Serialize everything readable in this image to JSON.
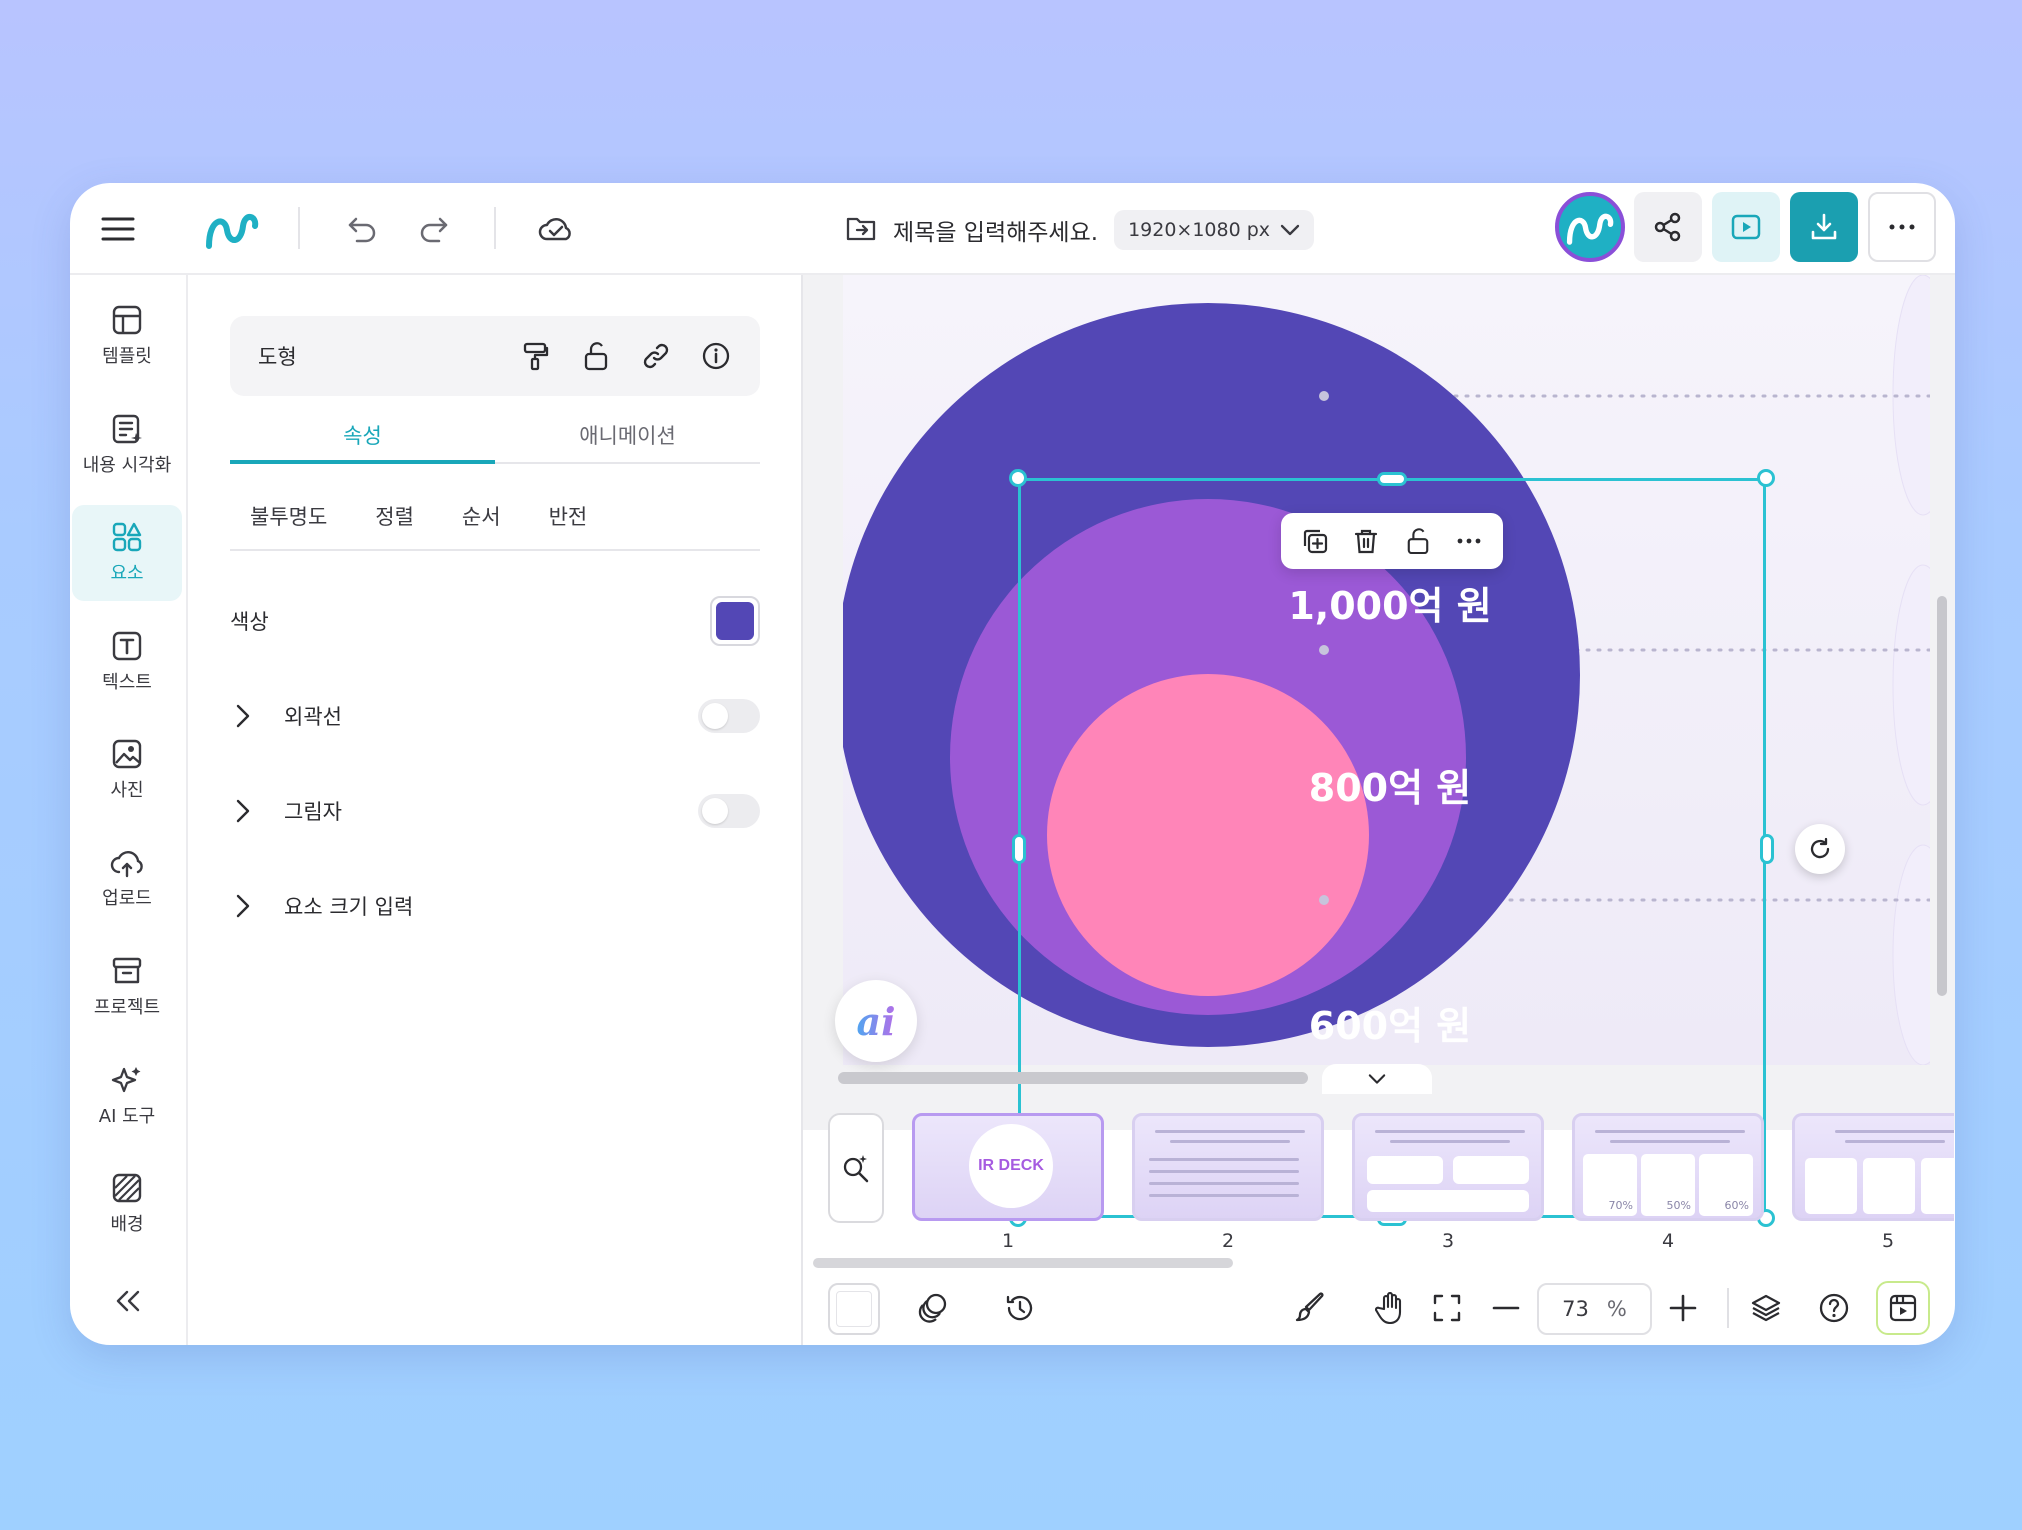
{
  "topbar": {
    "title": "제목을 입력해주세요.",
    "size_label": "1920×1080 px"
  },
  "rail": {
    "items": [
      {
        "label": "템플릿",
        "icon": "template-icon"
      },
      {
        "label": "내용 시각화",
        "icon": "visualize-icon"
      },
      {
        "label": "요소",
        "icon": "elements-icon",
        "active": true
      },
      {
        "label": "텍스트",
        "icon": "text-icon"
      },
      {
        "label": "사진",
        "icon": "photo-icon"
      },
      {
        "label": "업로드",
        "icon": "upload-icon"
      },
      {
        "label": "프로젝트",
        "icon": "project-icon"
      },
      {
        "label": "AI 도구",
        "icon": "ai-sparkle-icon"
      },
      {
        "label": "배경",
        "icon": "background-icon"
      }
    ]
  },
  "panel": {
    "header_label": "도형",
    "tabs": [
      "속성",
      "애니메이션"
    ],
    "subtabs": [
      "불투명도",
      "정렬",
      "순서",
      "반전"
    ],
    "color_label": "색상",
    "color_value": "#5347b5",
    "outline_label": "외곽선",
    "shadow_label": "그림자",
    "size_input_label": "요소 크기 입력"
  },
  "canvas": {
    "circles": [
      {
        "label": "1,000억 원",
        "color": "#5347b5"
      },
      {
        "label": "800억 원",
        "color": "#9b59d6"
      },
      {
        "label": "600억 원",
        "color": "#ff85b8"
      }
    ],
    "ai_button": "ai"
  },
  "slides": {
    "thumbs": [
      {
        "num": "1",
        "text": "IR DECK"
      },
      {
        "num": "2"
      },
      {
        "num": "3"
      },
      {
        "num": "4",
        "values": [
          "70%",
          "50%",
          "60%"
        ]
      },
      {
        "num": "5"
      }
    ]
  },
  "bottombar": {
    "zoom_value": "73",
    "zoom_unit": "%"
  },
  "colors": {
    "accent": "#19a7b9",
    "selection": "#2bc2d2",
    "download_bg": "#1b9fb0",
    "play_bg": "#dff3f6"
  }
}
